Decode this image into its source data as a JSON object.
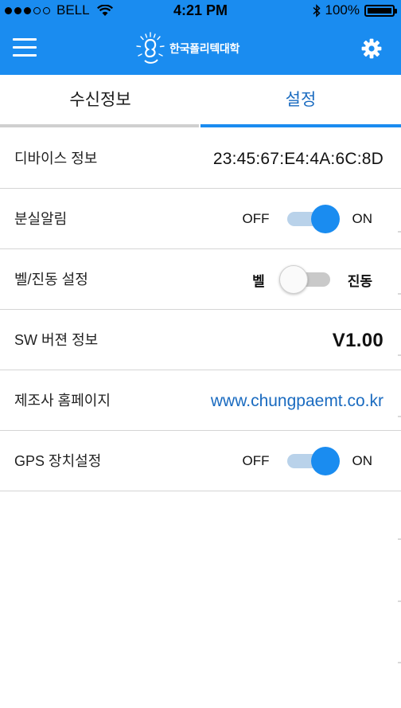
{
  "status_bar": {
    "signal_dots": [
      true,
      true,
      true,
      false,
      false
    ],
    "carrier": "BELL",
    "time": "4:21 PM",
    "battery": "100%",
    "battery_level": 1.0
  },
  "header": {
    "logo_text": "한국폴리텍대학",
    "menu_icon": "hamburger-menu-icon",
    "settings_icon": "gear-icon"
  },
  "tabs": [
    {
      "label": "수신정보",
      "active": false
    },
    {
      "label": "설정",
      "active": true
    }
  ],
  "settings": {
    "device_info": {
      "label": "디바이스 정보",
      "value": "23:45:67:E4:4A:6C:8D"
    },
    "loss_alarm": {
      "label": "분실알림",
      "off_label": "OFF",
      "on_label": "ON",
      "state": "on"
    },
    "bell_vibrate": {
      "label": "벨/진동 설정",
      "left_label": "벨",
      "right_label": "진동",
      "state": "left"
    },
    "sw_version": {
      "label": "SW 버젼 정보",
      "value": "V1.00"
    },
    "homepage": {
      "label": "제조사 홈페이지",
      "value": "www.chungpaemt.co.kr"
    },
    "gps": {
      "label": "GPS 장치설정",
      "off_label": "OFF",
      "on_label": "ON",
      "state": "on"
    }
  },
  "colors": {
    "primary": "#1a8cf0",
    "link": "#1a6bc0",
    "divider": "#d5d5d5"
  }
}
